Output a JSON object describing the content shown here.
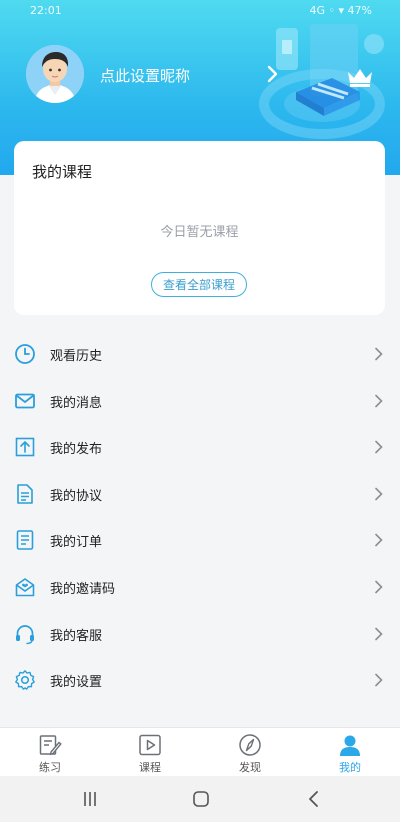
{
  "status": {
    "time": "22:01",
    "right": "4G ◦ ▾ 47%"
  },
  "header": {
    "nickname": "点此设置昵称",
    "accent": "#2db8ee"
  },
  "course_card": {
    "title": "我的课程",
    "empty_text": "今日暂无课程",
    "button_label": "查看全部课程"
  },
  "menu": {
    "items": [
      {
        "label": "观看历史",
        "icon": "clock-icon"
      },
      {
        "label": "我的消息",
        "icon": "mail-icon"
      },
      {
        "label": "我的发布",
        "icon": "upload-icon"
      },
      {
        "label": "我的协议",
        "icon": "document-icon"
      },
      {
        "label": "我的订单",
        "icon": "order-icon"
      },
      {
        "label": "我的邀请码",
        "icon": "invite-icon"
      },
      {
        "label": "我的客服",
        "icon": "headset-icon"
      },
      {
        "label": "我的设置",
        "icon": "gear-icon"
      }
    ]
  },
  "tabs": [
    {
      "label": "练习",
      "icon": "practice-icon"
    },
    {
      "label": "课程",
      "icon": "play-icon"
    },
    {
      "label": "发现",
      "icon": "compass-icon"
    },
    {
      "label": "我的",
      "icon": "user-icon",
      "active": true
    }
  ]
}
